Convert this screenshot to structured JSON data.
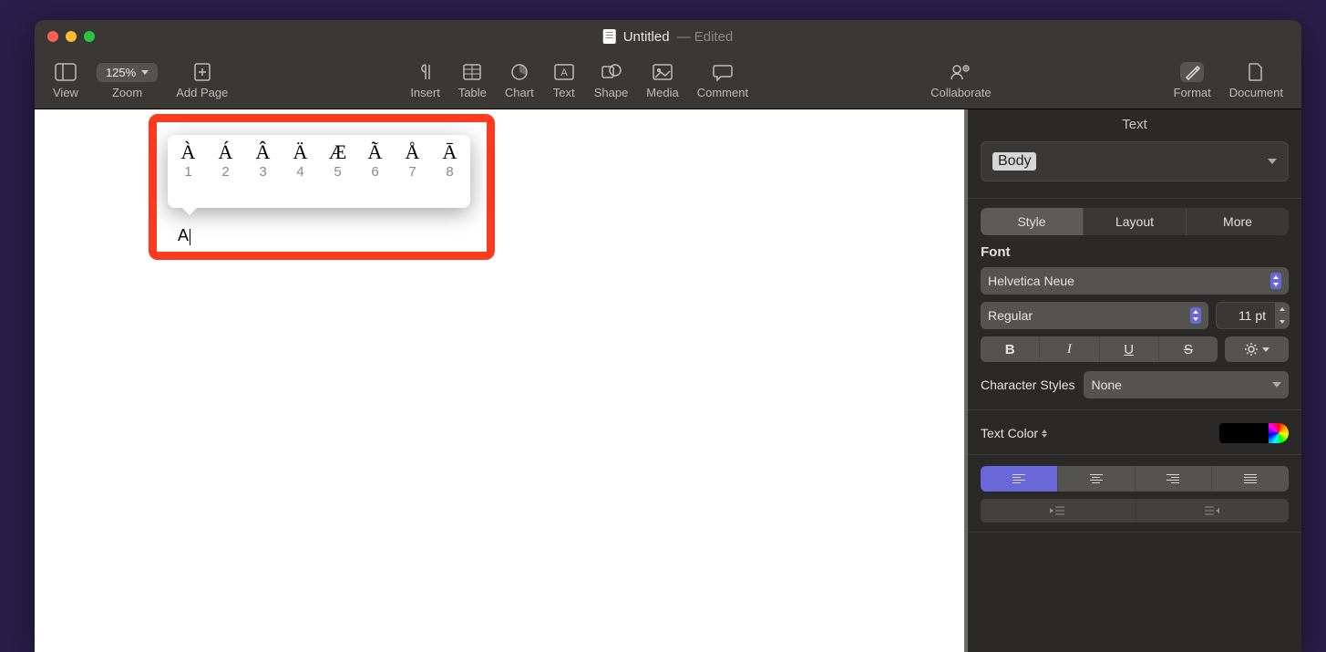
{
  "window": {
    "title": "Untitled",
    "status": "— Edited"
  },
  "toolbar": {
    "view": "View",
    "zoom_label": "Zoom",
    "zoom_value": "125%",
    "add_page": "Add Page",
    "insert": "Insert",
    "table": "Table",
    "chart": "Chart",
    "text": "Text",
    "shape": "Shape",
    "media": "Media",
    "comment": "Comment",
    "collaborate": "Collaborate",
    "format": "Format",
    "document": "Document"
  },
  "document": {
    "typed_char": "A"
  },
  "accent_popup": {
    "chars": [
      "À",
      "Á",
      "Â",
      "Ä",
      "Æ",
      "Ã",
      "Å",
      "Ā"
    ],
    "nums": [
      "1",
      "2",
      "3",
      "4",
      "5",
      "6",
      "7",
      "8"
    ]
  },
  "inspector": {
    "title": "Text",
    "paragraph_style": "Body",
    "tabs": {
      "style": "Style",
      "layout": "Layout",
      "more": "More"
    },
    "font_label": "Font",
    "font_family": "Helvetica Neue",
    "font_weight": "Regular",
    "font_size": "11 pt",
    "char_styles_label": "Character Styles",
    "char_styles_value": "None",
    "text_color_label": "Text Color",
    "text_color_value": "#000000",
    "bius": {
      "b": "B",
      "i": "I",
      "u": "U",
      "s": "S"
    }
  }
}
